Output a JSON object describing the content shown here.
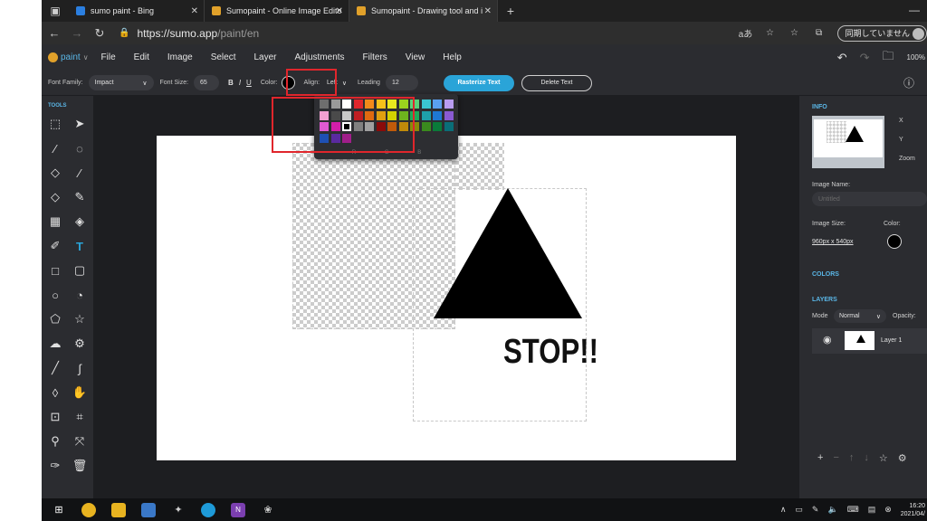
{
  "browser": {
    "tabs": [
      {
        "title": "sumo paint - Bing",
        "active": false,
        "favicon_color": "#2b7fe0"
      },
      {
        "title": "Sumopaint - Online Image Edito",
        "active": false,
        "favicon_color": "#e1a12a"
      },
      {
        "title": "Sumopaint - Drawing tool and i",
        "active": true,
        "favicon_color": "#e1a12a"
      }
    ],
    "url_host": "https://sumo.app",
    "url_path": "/paint/en",
    "sync_label": "同期していません"
  },
  "app": {
    "logo_text": "paint",
    "menu": [
      "File",
      "Edit",
      "Image",
      "Select",
      "Layer",
      "Adjustments",
      "Filters",
      "View",
      "Help"
    ],
    "zoom_level": "100%"
  },
  "options": {
    "font_family_label": "Font Family:",
    "font_family_value": "Impact",
    "font_size_label": "Font Size:",
    "font_size_value": "65",
    "bold": "B",
    "italic": "I",
    "underline": "U",
    "color_label": "Color:",
    "align_label": "Align:",
    "align_value": "Left",
    "leading_label": "Leading",
    "leading_value": "12",
    "rasterize_label": "Rasterize Text",
    "delete_label": "Delete Text"
  },
  "tools": {
    "title": "TOOLS",
    "items": [
      "marquee-select-icon",
      "move-arrow-icon",
      "magic-wand-icon",
      "lasso-icon",
      "fill-icon",
      "brush-icon",
      "eraser-icon",
      "pencil-icon",
      "gradient-icon",
      "paint-bucket-icon",
      "clone-stamp-icon",
      "text-tool-icon",
      "rectangle-icon",
      "rounded-rectangle-icon",
      "ellipse-icon",
      "pie-icon",
      "polygon-icon",
      "star-icon",
      "cloud-shape-icon",
      "gear-shape-icon",
      "line-icon",
      "curve-icon",
      "drop-icon",
      "hand-icon",
      "crop-icon",
      "crop-alt-icon",
      "zoom-icon",
      "fit-screen-icon",
      "eyedropper-icon",
      "trash-icon"
    ]
  },
  "canvas": {
    "text": "STOP!!"
  },
  "color_picker": {
    "swatches": [
      [
        "#6e6e6e",
        "#9a9a9a",
        "#ffffff",
        "#e0262c",
        "#f28a1a",
        "#f4c21a",
        "#e8e81e",
        "#9bd21e",
        "#5ad27a",
        "#3ac6d2",
        "#5aa0f0",
        "#b89cf0"
      ],
      [
        "#f2a0d2",
        "#4a4a4a",
        "#c8c8c8",
        "#c01e22",
        "#e06a10",
        "#e0a010",
        "#d2d200",
        "#6eb41e",
        "#1eaa5a",
        "#1ea0aa",
        "#1e78d2",
        "#8a5ad2"
      ],
      [
        "#e05ad2",
        "#d21eaa",
        "#000000",
        "#808080",
        "#a0a0a0",
        "#8a0a0a",
        "#c05a0a",
        "#c08a0a",
        "#8a8a0a",
        "#3a8a1e",
        "#0a7a3a",
        "#0a6e78"
      ],
      [
        "#1e50b4",
        "#5a2aa0",
        "#a01e8a"
      ]
    ],
    "channel_labels": [
      "",
      "R",
      "G",
      "B",
      ""
    ]
  },
  "right_panel": {
    "info_title": "INFO",
    "x_label": "X",
    "y_label": "Y",
    "zoom_label": "Zoom",
    "image_name_label": "Image Name:",
    "image_name_placeholder": "Untitled",
    "image_size_label": "Image Size:",
    "image_size_value": "960px x 540px",
    "color_label": "Color:",
    "colors_title": "COLORS",
    "layers_title": "LAYERS",
    "mode_label": "Mode",
    "mode_value": "Normal",
    "opacity_label": "Opacity:",
    "layer_name": "Layer 1"
  },
  "taskbar": {
    "time": "16:20",
    "date": "2021/04/"
  }
}
